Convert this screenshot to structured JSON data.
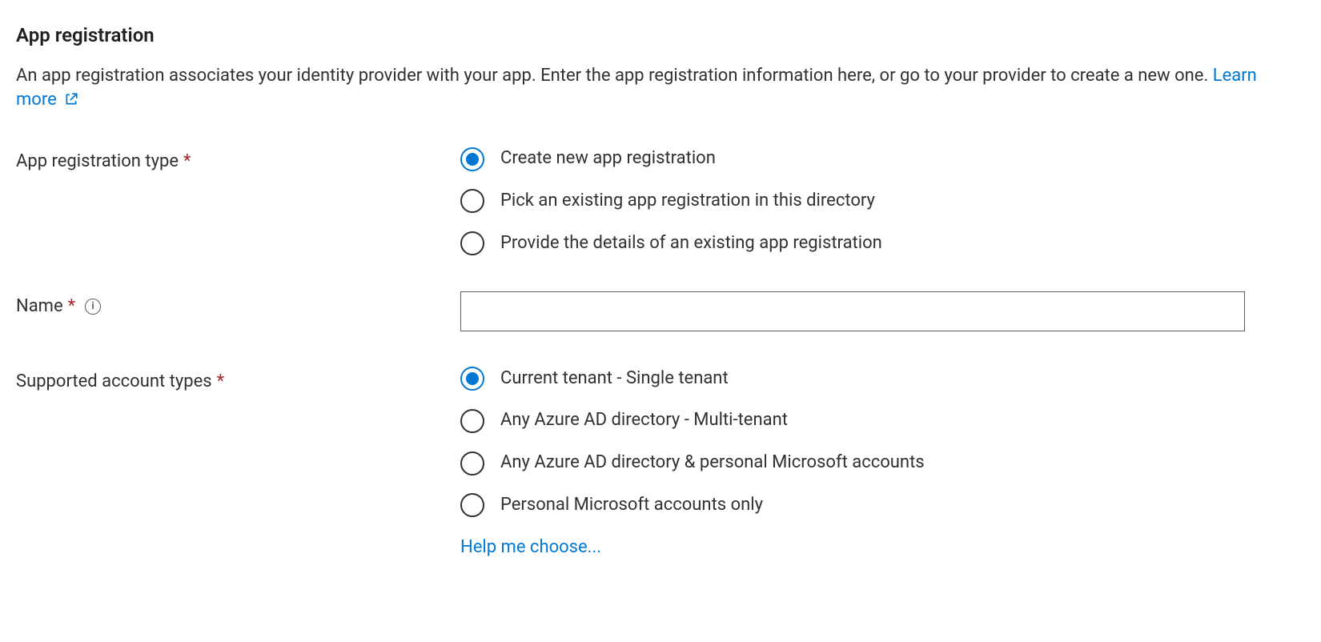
{
  "section": {
    "title": "App registration",
    "description_part1": "An app registration associates your identity provider with your app. Enter the app registration information here, or go to your provider to create a new one. ",
    "learn_more": "Learn more"
  },
  "fields": {
    "reg_type": {
      "label": "App registration type",
      "options": [
        {
          "label": "Create new app registration",
          "checked": true
        },
        {
          "label": "Pick an existing app registration in this directory",
          "checked": false
        },
        {
          "label": "Provide the details of an existing app registration",
          "checked": false
        }
      ]
    },
    "name": {
      "label": "Name",
      "value": "",
      "info_glyph": "i"
    },
    "account_types": {
      "label": "Supported account types",
      "options": [
        {
          "label": "Current tenant - Single tenant",
          "checked": true
        },
        {
          "label": "Any Azure AD directory - Multi-tenant",
          "checked": false
        },
        {
          "label": "Any Azure AD directory & personal Microsoft accounts",
          "checked": false
        },
        {
          "label": "Personal Microsoft accounts only",
          "checked": false
        }
      ],
      "help_link": "Help me choose..."
    }
  },
  "glyphs": {
    "required": "*"
  }
}
